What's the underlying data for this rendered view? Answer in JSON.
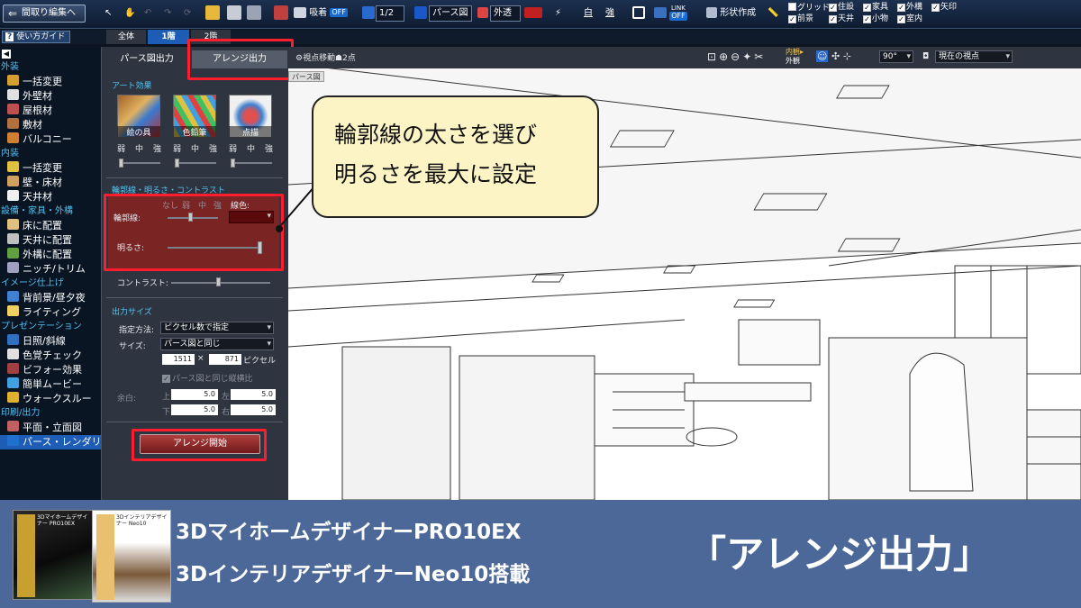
{
  "toolbar": {
    "back_label": "間取り編集へ",
    "snap_label": "吸着",
    "snap_state": "OFF",
    "scale_value": "1/2",
    "view_select": "パース図",
    "exterior_select": "外透",
    "style_labels": [
      "白",
      "強"
    ],
    "link_label": "LINK",
    "link_state": "OFF",
    "shape_create_label": "形状作成",
    "checks": [
      {
        "label": "グリッド",
        "checked": false
      },
      {
        "label": "住設",
        "checked": true
      },
      {
        "label": "家具",
        "checked": true
      },
      {
        "label": "外構",
        "checked": true
      },
      {
        "label": "矢印",
        "checked": true
      },
      {
        "label": "前景",
        "checked": true
      },
      {
        "label": "天井",
        "checked": true
      },
      {
        "label": "小物",
        "checked": true
      },
      {
        "label": "室内",
        "checked": true
      }
    ]
  },
  "tabs": {
    "guide": "使い方ガイド",
    "floors": [
      "全体",
      "1階",
      "2階"
    ]
  },
  "sidebar": {
    "groups": [
      {
        "title": "外装",
        "items": [
          "一括変更",
          "外壁材",
          "屋根材",
          "敷材",
          "バルコニー"
        ]
      },
      {
        "title": "内装",
        "items": [
          "一括変更",
          "壁・床材",
          "天井材"
        ]
      },
      {
        "title": "設備・家具・外構",
        "items": [
          "床に配置",
          "天井に配置",
          "外構に配置",
          "ニッチ/トリム"
        ]
      },
      {
        "title": "イメージ仕上げ",
        "items": [
          "背前景/昼夕夜",
          "ライティング"
        ]
      },
      {
        "title": "プレゼンテーション",
        "items": [
          "日照/斜線",
          "色覚チェック",
          "ビフォー効果",
          "簡単ムービー",
          "ウォークスルー"
        ]
      },
      {
        "title": "印刷/出力",
        "items": [
          "平面・立面図",
          "パース・レンダリング"
        ]
      }
    ]
  },
  "panel": {
    "tab_pers": "パース図出力",
    "tab_arrange": "アレンジ出力",
    "art_title": "アート効果",
    "arts": [
      "絵の具",
      "色鉛筆",
      "点描"
    ],
    "strength": [
      "弱",
      "中",
      "強"
    ],
    "outline_title": "輪郭線・明るさ・コントラスト",
    "outline_label": "輪郭線:",
    "outline_levels": [
      "なし",
      "弱",
      "中",
      "強"
    ],
    "line_color_label": "線色:",
    "brightness_label": "明るさ:",
    "contrast_label": "コントラスト:",
    "output_title": "出力サイズ",
    "method_label": "指定方法:",
    "method_value": "ピクセル数で指定",
    "size_label": "サイズ:",
    "size_value": "パース図と同じ",
    "width": "1511",
    "times": "×",
    "height": "871",
    "pixel_unit": "ピクセル",
    "same_ratio": "パース図と同じ縦横比",
    "margin_label": "余白:",
    "margin_top_label": "上",
    "margin_top": "5.0",
    "margin_left_label": "左",
    "margin_left": "5.0",
    "margin_bottom_label": "下",
    "margin_bottom": "5.0",
    "margin_right_label": "右",
    "margin_right": "5.0",
    "start_button": "アレンジ開始",
    "outline_level": 0.45,
    "brightness_level": 1.0,
    "contrast_level": 0.5
  },
  "viewbar": {
    "move_label": "視点移動",
    "point2_label": "2点",
    "interior_label": "内観",
    "exterior_label": "外観",
    "angle": "90°",
    "viewpoint": "現在の視点"
  },
  "viewport_label": "パース図",
  "callout": {
    "line1": "輪郭線の太さを選び",
    "line2": "明るさを最大に設定"
  },
  "banner": {
    "product1": "3DマイホームデザイナーPRO10EX",
    "product2": "3DインテリアデザイナーNeo10搭載",
    "feature": "「アレンジ出力」",
    "box1_text": "3Dマイホームデザイナー PRO10EX",
    "box2_text": "3Dインテリアデザイナー Neo10"
  },
  "colors": {
    "accent": "#ff1e2e",
    "banner": "#4c6898",
    "callout": "#fdf4c6"
  }
}
